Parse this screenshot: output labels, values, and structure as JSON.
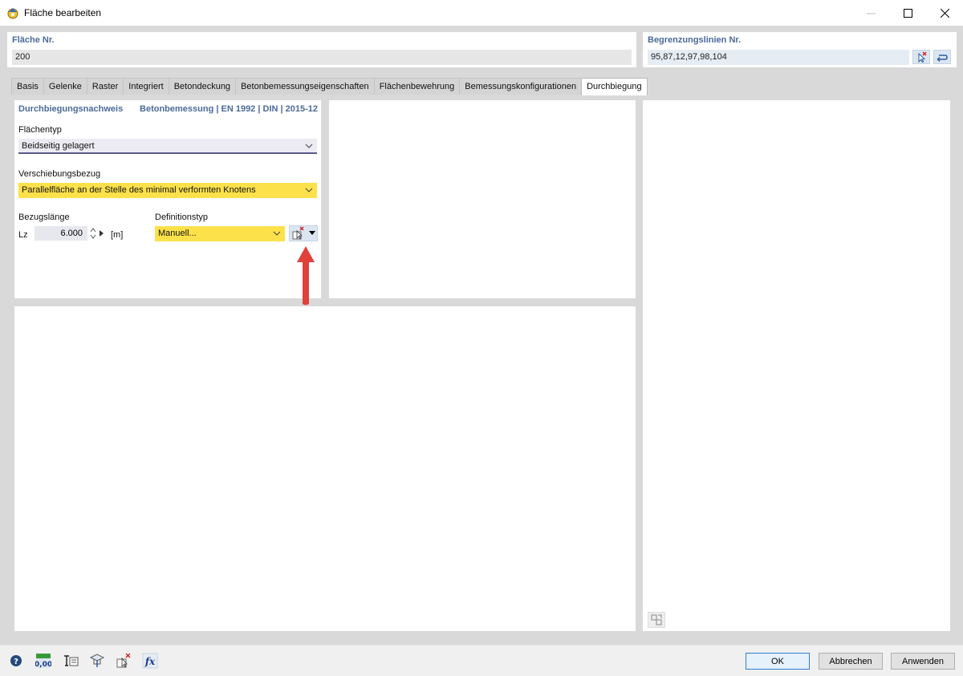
{
  "window": {
    "title": "Fläche bearbeiten"
  },
  "surface_no": {
    "header": "Fläche Nr.",
    "value": "200"
  },
  "boundary_lines": {
    "header": "Begrenzungslinien Nr.",
    "value": "95,87,12,97,98,104"
  },
  "tabs": [
    {
      "label": "Basis"
    },
    {
      "label": "Gelenke"
    },
    {
      "label": "Raster"
    },
    {
      "label": "Integriert"
    },
    {
      "label": "Betondeckung"
    },
    {
      "label": "Betonbemessungseigenschaften"
    },
    {
      "label": "Flächenbewehrung"
    },
    {
      "label": "Bemessungskonfigurationen"
    },
    {
      "label": "Durchbiegung"
    }
  ],
  "deflection": {
    "header_left": "Durchbiegungsnachweis",
    "header_right": "Betonbemessung | EN 1992 | DIN | 2015-12",
    "surface_type_label": "Flächentyp",
    "surface_type_value": "Beidseitig gelagert",
    "displacement_ref_label": "Verschiebungsbezug",
    "displacement_ref_value": "Parallelfläche an der Stelle des minimal verformten Knotens",
    "ref_length_label": "Bezugslänge",
    "lz_symbol": "Lz",
    "lz_value": "6.000",
    "lz_unit": "[m]",
    "definition_type_label": "Definitionstyp",
    "definition_type_value": "Manuell..."
  },
  "buttons": {
    "ok": "OK",
    "cancel": "Abbrechen",
    "apply": "Anwenden"
  },
  "toolbar_icons": [
    "help-icon",
    "number-format-icon",
    "model-view-icon",
    "display-icon",
    "select-delete-icon",
    "formula-icon"
  ],
  "colors": {
    "accent_header": "#4a6a9a",
    "highlight_yellow": "#fde14a",
    "arrow_red": "#e0413b"
  }
}
